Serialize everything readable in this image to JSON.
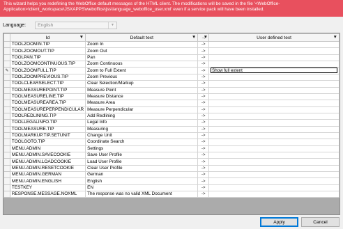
{
  "banner": {
    "line1": "This wizard helps you redefining the WebOffice default messages of the HTML client. The modifications will be saved in the file '<WebOffice-",
    "line2": "Application>\\client_workspace\\JSXAPPS\\weboffice\\jss\\language_weboffice_user.xml' even if a service pack will have been installed."
  },
  "language": {
    "label": "Language:",
    "value": "English",
    "arrow": "▼"
  },
  "grid": {
    "columns": {
      "id": "Id",
      "default": "Default text",
      "user": "User defined text"
    },
    "filter_icon": "▼",
    "arrow_header": "→",
    "arrow_text": "->",
    "current_row_marker": "✎",
    "rows": [
      {
        "id": "TOOLZOOMIN.TIP",
        "default": "Zoom In",
        "user": ""
      },
      {
        "id": "TOOLZOOMOUT.TIP",
        "default": "Zoom Out",
        "user": ""
      },
      {
        "id": "TOOLPAN.TIP",
        "default": "Pan",
        "user": ""
      },
      {
        "id": "TOOLZOOMCONTINUOUS.TIP",
        "default": "Zoom Continuous",
        "user": ""
      },
      {
        "id": "TOOLZOOMFULL.TIP",
        "default": "Zoom to Full Extent",
        "user": "Show full extent"
      },
      {
        "id": "TOOLZOOMPREVIOUS.TIP",
        "default": "Zoom Previous",
        "user": ""
      },
      {
        "id": "TOOLCLEARSELECT.TIP",
        "default": "Clear Selection/Markup",
        "user": ""
      },
      {
        "id": "TOOLMEASUREPOINT.TIP",
        "default": "Measure Point",
        "user": ""
      },
      {
        "id": "TOOLMEASURELINE.TIP",
        "default": "Measure Distance",
        "user": ""
      },
      {
        "id": "TOOLMEASUREAREA.TIP",
        "default": "Measure Area",
        "user": ""
      },
      {
        "id": "TOOLMEASUREPERPENDICULAR",
        "default": "Measure Perpendicular",
        "user": ""
      },
      {
        "id": "TOOLREDLINING.TIP",
        "default": "Add Redlining",
        "user": ""
      },
      {
        "id": "TOOLLEGALINFO.TIP",
        "default": "Legal Info",
        "user": ""
      },
      {
        "id": "TOOLMEASURE.TIP",
        "default": "Measuring",
        "user": ""
      },
      {
        "id": "TOOLMARKUP.TIP.SETUNIT",
        "default": "Change Unit",
        "user": ""
      },
      {
        "id": "TOOLGOTO.TIP",
        "default": "Coordinate Search",
        "user": ""
      },
      {
        "id": "MENU.ADMIN",
        "default": "Settings",
        "user": ""
      },
      {
        "id": "MENU.ADMIN.SAVECOOKIE",
        "default": "Save User Profile",
        "user": ""
      },
      {
        "id": "MENU.ADMIN.LOADCOOKIE",
        "default": "Load User Profile",
        "user": ""
      },
      {
        "id": "MENU.ADMIN.RESETCOOKIE",
        "default": "Clear User Profile",
        "user": ""
      },
      {
        "id": "MENU.ADMIN.GERMAN",
        "default": "German",
        "user": ""
      },
      {
        "id": "MENU.ADMIN.ENGLISH",
        "default": "English",
        "user": ""
      },
      {
        "id": "TESTKEY",
        "default": "EN",
        "user": ""
      },
      {
        "id": "RESPONSE.MESSAGE.NOXML",
        "default": "The response was no valid XML Document",
        "user": ""
      }
    ]
  },
  "buttons": {
    "apply": "Apply",
    "cancel": "Cancel"
  }
}
